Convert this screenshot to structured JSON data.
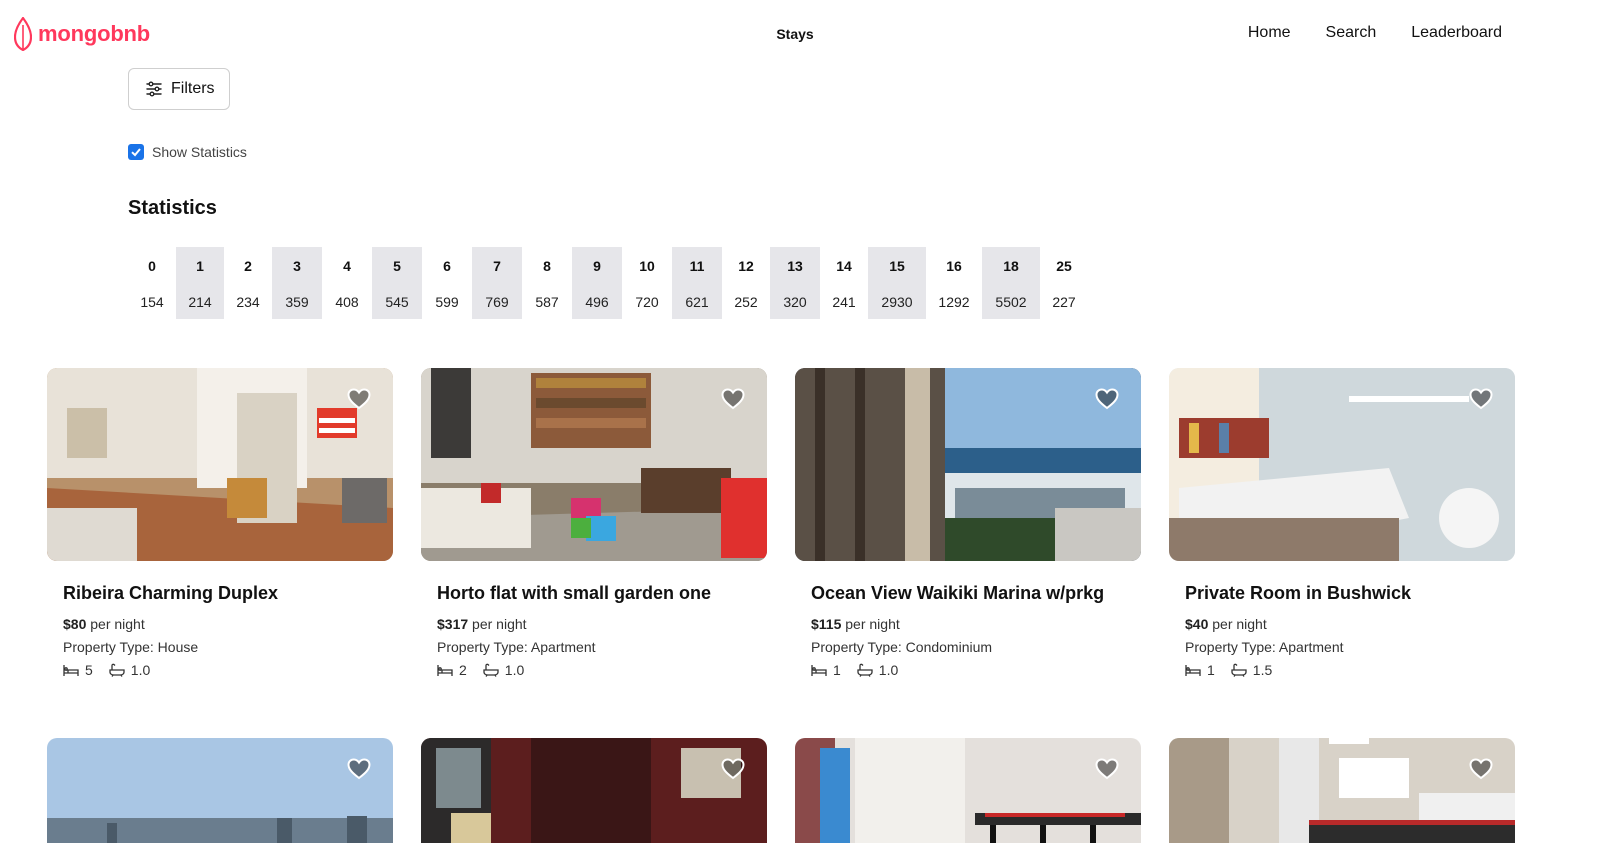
{
  "header": {
    "brand": "mongobnb",
    "center": "Stays",
    "nav": [
      "Home",
      "Search",
      "Leaderboard"
    ]
  },
  "filters": {
    "label": "Filters"
  },
  "stats_toggle": {
    "label": "Show Statistics",
    "checked": true
  },
  "statistics": {
    "title": "Statistics",
    "columns": [
      {
        "k": "0",
        "v": "154"
      },
      {
        "k": "1",
        "v": "214"
      },
      {
        "k": "2",
        "v": "234"
      },
      {
        "k": "3",
        "v": "359"
      },
      {
        "k": "4",
        "v": "408"
      },
      {
        "k": "5",
        "v": "545"
      },
      {
        "k": "6",
        "v": "599"
      },
      {
        "k": "7",
        "v": "769"
      },
      {
        "k": "8",
        "v": "587"
      },
      {
        "k": "9",
        "v": "496"
      },
      {
        "k": "10",
        "v": "720"
      },
      {
        "k": "11",
        "v": "621"
      },
      {
        "k": "12",
        "v": "252"
      },
      {
        "k": "13",
        "v": "320"
      },
      {
        "k": "14",
        "v": "241"
      },
      {
        "k": "15",
        "v": "2930"
      },
      {
        "k": "16",
        "v": "1292"
      },
      {
        "k": "18",
        "v": "5502"
      },
      {
        "k": "25",
        "v": "227"
      }
    ]
  },
  "listings": [
    {
      "title": "Ribeira Charming Duplex",
      "price": "$80",
      "price_suffix": "per night",
      "property_type": "Property Type: House",
      "beds": "5",
      "baths": "1.0"
    },
    {
      "title": "Horto flat with small garden one",
      "price": "$317",
      "price_suffix": "per night",
      "property_type": "Property Type: Apartment",
      "beds": "2",
      "baths": "1.0"
    },
    {
      "title": "Ocean View Waikiki Marina w/prkg",
      "price": "$115",
      "price_suffix": "per night",
      "property_type": "Property Type: Condominium",
      "beds": "1",
      "baths": "1.0"
    },
    {
      "title": "Private Room in Bushwick",
      "price": "$40",
      "price_suffix": "per night",
      "property_type": "Property Type: Apartment",
      "beds": "1",
      "baths": "1.5"
    }
  ],
  "colors": {
    "brand": "#ff385c",
    "checkbox": "#1a73e8",
    "stats_shade": "#e6e6ea"
  }
}
